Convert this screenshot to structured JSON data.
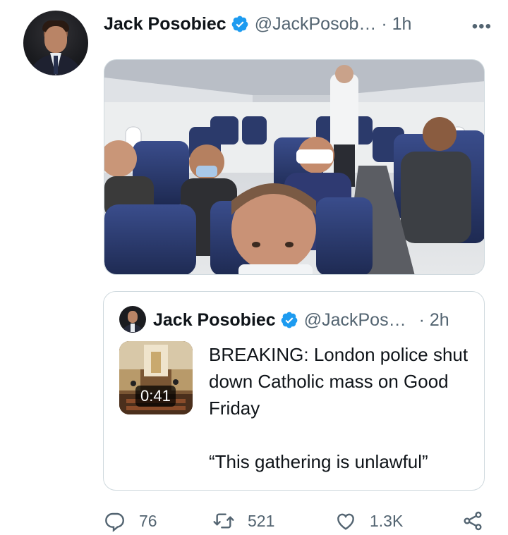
{
  "tweet": {
    "author_name": "Jack Posobiec",
    "handle_time": "@JackPosob… · 1h",
    "more_label": "•••"
  },
  "quoted": {
    "author_name": "Jack Posobiec",
    "handle": "@JackPos…",
    "time": "· 2h",
    "video_duration": "0:41",
    "text_line1": "BREAKING: London police shut down Catholic mass on Good Friday",
    "text_line2": "“This gathering is unlawful”"
  },
  "actions": {
    "replies": "76",
    "retweets": "521",
    "likes": "1.3K"
  },
  "icons": [
    "verified-badge-icon",
    "more-icon",
    "reply-icon",
    "retweet-icon",
    "like-icon",
    "share-icon"
  ],
  "colors": {
    "verified": "#1d9bf0",
    "secondary_text": "#536471",
    "border": "#cfd9de"
  }
}
